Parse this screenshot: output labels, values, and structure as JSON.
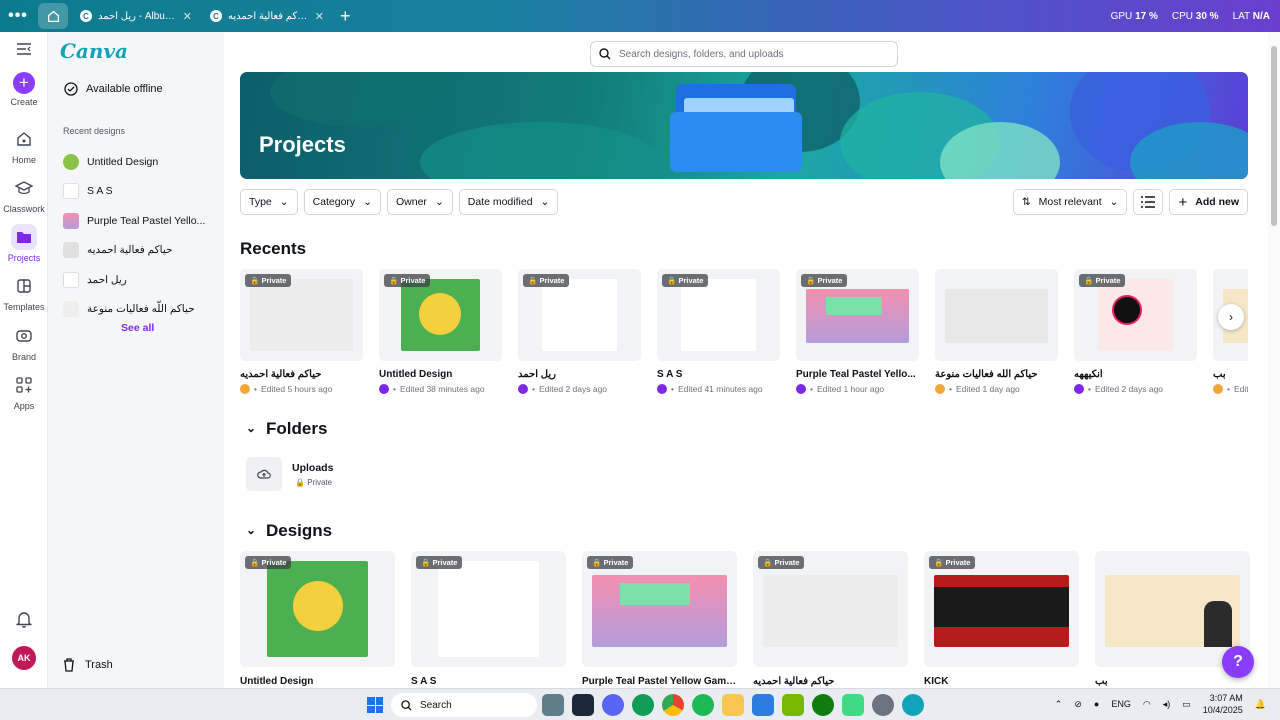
{
  "browser": {
    "tabs": [
      {
        "label": "ريل احمد - Album Co...",
        "icon": "canva-icon"
      },
      {
        "label": "حياكم فعالية احمديه - ...",
        "icon": "canva-icon"
      }
    ],
    "stats": {
      "gpu_label": "GPU",
      "gpu_value": "17 %",
      "cpu_label": "CPU",
      "cpu_value": "30 %",
      "lat_label": "LAT",
      "lat_value": "N/A"
    }
  },
  "rail": {
    "create": "Create",
    "home": "Home",
    "classwork": "Classwork",
    "projects": "Projects",
    "templates": "Templates",
    "brand": "Brand",
    "apps": "Apps",
    "avatar": "AK"
  },
  "panel": {
    "logo": "Canva",
    "offline": "Available offline",
    "recent_label": "Recent designs",
    "recent": [
      {
        "label": "Untitled Design",
        "color": "#8bc34a"
      },
      {
        "label": "S A S",
        "color": "#ffffff"
      },
      {
        "label": "Purple Teal Pastel Yello...",
        "color": "#f48fb1"
      },
      {
        "label": "حياكم فعالية احمديه",
        "color": "#e0e0e0"
      },
      {
        "label": "ريل احمد",
        "color": "#ffffff"
      },
      {
        "label": "حياكم اللّه فعاليات منوعة",
        "color": "#eeeeee"
      }
    ],
    "see_all": "See all",
    "trash": "Trash"
  },
  "main": {
    "search_placeholder": "Search designs, folders, and uploads",
    "hero_title": "Projects",
    "filters": [
      "Type",
      "Category",
      "Owner",
      "Date modified"
    ],
    "sort_label": "Most relevant",
    "add_new": "Add new",
    "recents_heading": "Recents",
    "private_label": "Private",
    "recents": [
      {
        "title": "حياكم فعالية احمديه",
        "meta": "Edited 5 hours ago",
        "dot": "#f0a73a",
        "bg": "#ececec",
        "private": true
      },
      {
        "title": "Untitled Design",
        "meta": "Edited 38 minutes ago",
        "dot": "#7d2ae8",
        "bg": "#4caf50",
        "private": true
      },
      {
        "title": "ريل احمد",
        "meta": "Edited 2 days ago",
        "dot": "#7d2ae8",
        "bg": "#ffffff",
        "private": true
      },
      {
        "title": "S A S",
        "meta": "Edited 41 minutes ago",
        "dot": "#7d2ae8",
        "bg": "#ffffff",
        "private": true
      },
      {
        "title": "Purple Teal Pastel Yello...",
        "meta": "Edited 1 hour ago",
        "dot": "#7d2ae8",
        "bg": "#f48fb1",
        "private": true
      },
      {
        "title": "حياكم اللّه فعاليات منوعة",
        "meta": "Edited 1 day ago",
        "dot": "#f0a73a",
        "bg": "#e8e8e8",
        "private": false
      },
      {
        "title": "انكيههه",
        "meta": "Edited 2 days ago",
        "dot": "#7d2ae8",
        "bg": "#fbe9e7",
        "private": true
      },
      {
        "title": "بب",
        "meta": "Edite...",
        "dot": "#f0a73a",
        "bg": "#f5e6c8",
        "private": false
      }
    ],
    "folders_heading": "Folders",
    "folder": {
      "name": "Uploads",
      "privacy": "Private"
    },
    "designs_heading": "Designs",
    "designs": [
      {
        "title": "Untitled Design",
        "bg": "#4caf50",
        "private": true
      },
      {
        "title": "S A S",
        "bg": "#ffffff",
        "private": true
      },
      {
        "title": "Purple Teal Pastel Yellow Game...",
        "bg": "#f48fb1",
        "private": true
      },
      {
        "title": "حياكم فعالية احمديه",
        "bg": "#ececec",
        "private": true
      },
      {
        "title": "KICK",
        "bg": "#b71c1c",
        "private": true
      },
      {
        "title": "بب",
        "bg": "#f5e6c8",
        "private": false
      }
    ],
    "help": "?"
  },
  "taskbar": {
    "search": "Search",
    "lang": "ENG",
    "time": "3:07 AM",
    "date": "10/4/2025"
  }
}
